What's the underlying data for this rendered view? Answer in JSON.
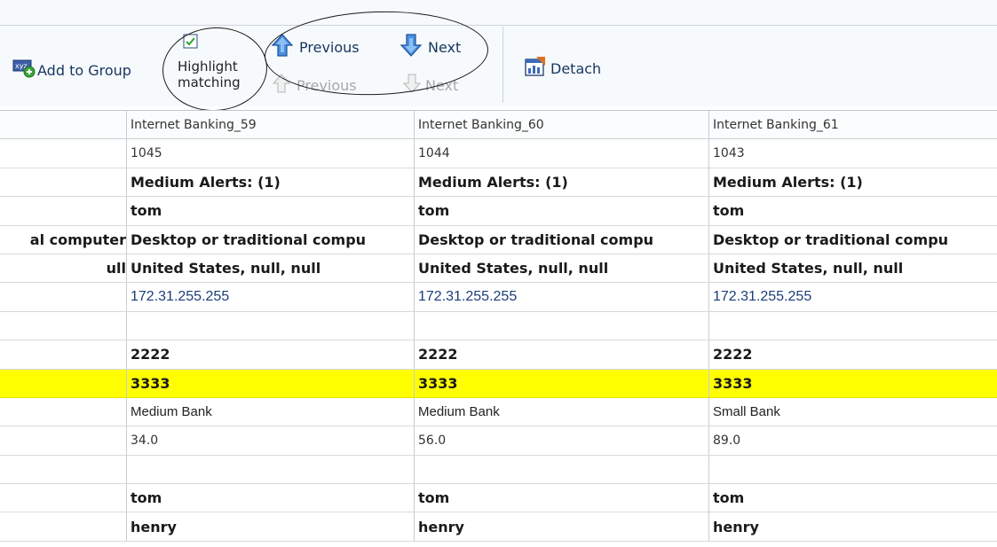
{
  "toolbar": {
    "add_to_group": "Add to Group",
    "highlight_line1": "Highlight",
    "highlight_line2": "matching",
    "highlight_checked": true,
    "previous_active": "Previous",
    "next_active": "Next",
    "previous_disabled": "Previous",
    "next_disabled": "Next",
    "detach": "Detach"
  },
  "table": {
    "header": [
      "",
      "Internet Banking_59",
      "Internet Banking_60",
      "Internet Banking_61"
    ],
    "rows": [
      {
        "style": "plain",
        "cells": [
          "",
          "1045",
          "1044",
          "1043"
        ]
      },
      {
        "style": "bold",
        "cells": [
          "",
          "Medium Alerts: (1)",
          "Medium Alerts: (1)",
          "Medium Alerts: (1)"
        ]
      },
      {
        "style": "bold",
        "cells": [
          "",
          "tom",
          "tom",
          "tom"
        ]
      },
      {
        "style": "bold",
        "cells": [
          "al computer",
          "Desktop or traditional compu",
          "Desktop or traditional compu",
          "Desktop or traditional compu"
        ]
      },
      {
        "style": "bold",
        "cells": [
          "ull",
          "United States, null, null",
          "United States, null, null",
          "United States, null, null"
        ]
      },
      {
        "style": "ip",
        "cells": [
          "",
          "172.31.255.255",
          "172.31.255.255",
          "172.31.255.255"
        ]
      },
      {
        "style": "plain",
        "cells": [
          "",
          "",
          "",
          ""
        ]
      },
      {
        "style": "bold",
        "cells": [
          "",
          "2222",
          "2222",
          "2222"
        ]
      },
      {
        "style": "bold",
        "highlight": true,
        "cells": [
          "",
          "3333",
          "3333",
          "3333"
        ]
      },
      {
        "style": "bank",
        "cells": [
          "",
          "Medium Bank",
          "Medium Bank",
          "Small Bank"
        ]
      },
      {
        "style": "plain",
        "cells": [
          "",
          "34.0",
          "56.0",
          "89.0"
        ]
      },
      {
        "style": "plain",
        "cells": [
          "",
          "",
          "",
          ""
        ]
      },
      {
        "style": "bold",
        "cells": [
          "",
          "tom",
          "tom",
          "tom"
        ]
      },
      {
        "style": "bold",
        "cells": [
          "",
          "henry",
          "henry",
          "henry"
        ]
      }
    ]
  },
  "colors": {
    "highlight_row": "#ffff00",
    "toolbar_text": "#16365e",
    "disabled_text": "#a8a8a8",
    "ip_text": "#1c3d78"
  },
  "icons": {
    "add_to_group": "group-add-icon",
    "highlight": "checkbox-checked-icon",
    "previous": "arrow-up-icon",
    "next": "arrow-down-icon",
    "detach": "detach-window-icon"
  }
}
